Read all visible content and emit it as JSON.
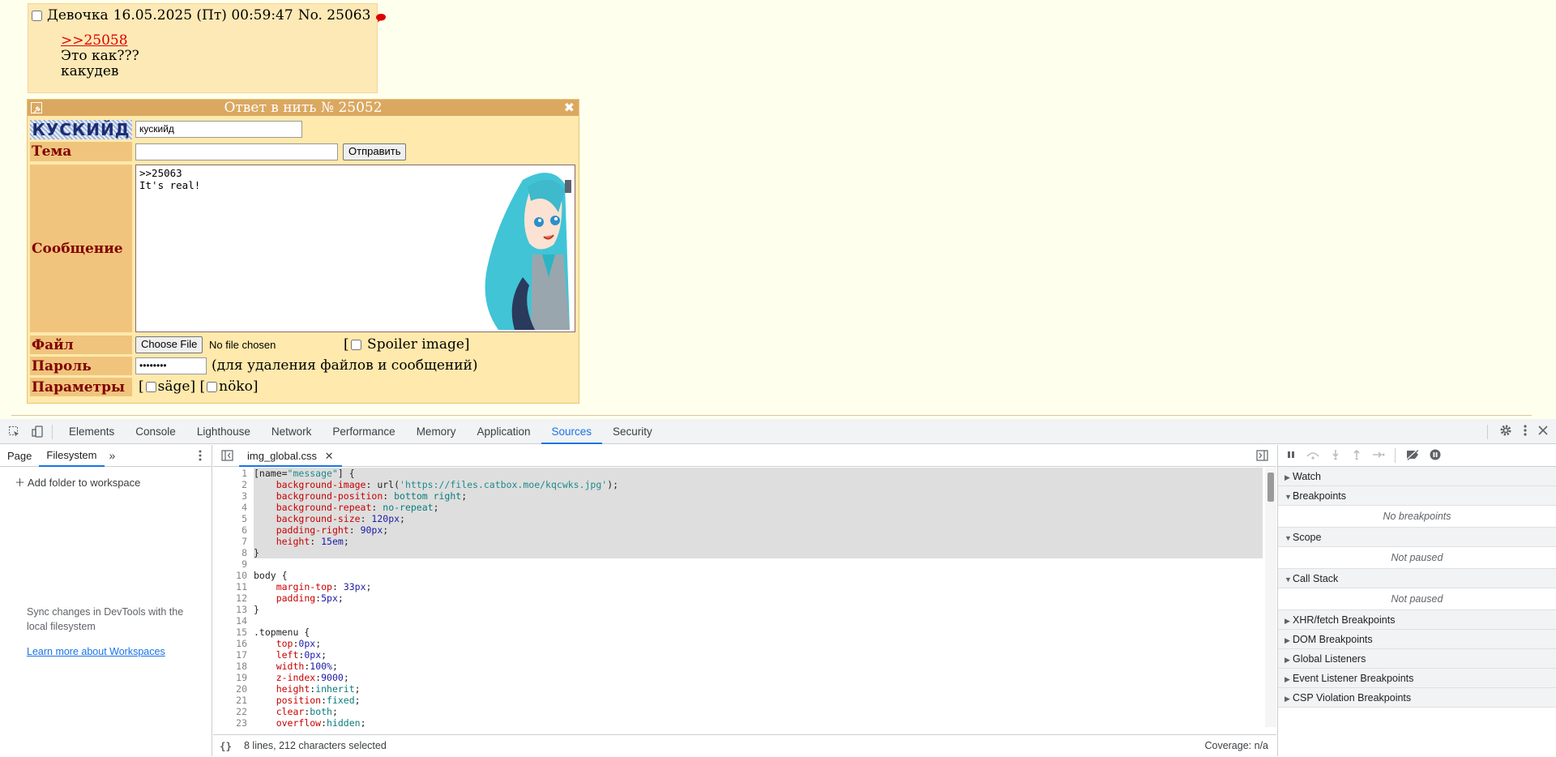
{
  "post": {
    "author": "Девочка",
    "date": "16.05.2025 (Пт) 00:59:47",
    "number_label": "No. 25063",
    "reply_link": ">>25058",
    "lines": [
      "Это как???",
      "какудев"
    ]
  },
  "reply_form": {
    "title": "Ответ в нить № 25052",
    "captcha_text": "КУСКИЙД",
    "captcha_value": "кускийд",
    "subject_label": "Тема",
    "submit_label": "Отправить",
    "message_label": "Сообщение",
    "message_lines": [
      ">>25063",
      "It's real!"
    ],
    "file_label": "Файл",
    "choose_file_label": "Choose File",
    "no_file_text": "No file chosen",
    "spoiler_label": "Spoiler image",
    "password_label": "Пароль",
    "password_value": "••••••••",
    "password_hint": "(для удаления файлов и сообщений)",
    "params_label": "Параметры",
    "sage_label": "säge",
    "noko_label": "nöko"
  },
  "devtools": {
    "tabs": [
      "Elements",
      "Console",
      "Lighthouse",
      "Network",
      "Performance",
      "Memory",
      "Application",
      "Sources",
      "Security"
    ],
    "active_tab": "Sources",
    "navigator": {
      "tabs": [
        "Page",
        "Filesystem"
      ],
      "active_tab": "Filesystem",
      "add_folder": "Add folder to workspace",
      "sync_text": "Sync changes in DevTools with the local filesystem",
      "learn_link": "Learn more about Workspaces"
    },
    "editor": {
      "file_tab": "img_global.css",
      "status_selection": "8 lines, 212 characters selected",
      "coverage": "Coverage: n/a",
      "code": [
        "[name=\"message\"] {",
        "    background-image: url('https://files.catbox.moe/kqcwks.jpg');",
        "    background-position: bottom right;",
        "    background-repeat: no-repeat;",
        "    background-size: 120px;",
        "    padding-right: 90px;",
        "    height: 15em;",
        "}",
        "",
        "body {",
        "    margin-top: 33px;",
        "    padding:5px;",
        "}",
        "",
        ".topmenu {",
        "    top:0px;",
        "    left:0px;",
        "    width:100%;",
        "    z-index:9000;",
        "    height:inherit;",
        "    position:fixed;",
        "    clear:both;",
        "    overflow:hidden;"
      ]
    },
    "debugger": {
      "sections": [
        {
          "title": "Watch",
          "open": false,
          "empty": ""
        },
        {
          "title": "Breakpoints",
          "open": true,
          "empty": "No breakpoints"
        },
        {
          "title": "Scope",
          "open": true,
          "empty": "Not paused"
        },
        {
          "title": "Call Stack",
          "open": true,
          "empty": "Not paused"
        },
        {
          "title": "XHR/fetch Breakpoints",
          "open": false,
          "empty": ""
        },
        {
          "title": "DOM Breakpoints",
          "open": false,
          "empty": ""
        },
        {
          "title": "Global Listeners",
          "open": false,
          "empty": ""
        },
        {
          "title": "Event Listener Breakpoints",
          "open": false,
          "empty": ""
        },
        {
          "title": "CSP Violation Breakpoints",
          "open": false,
          "empty": ""
        }
      ]
    }
  },
  "colors": {
    "accent": "#1a73e8",
    "post_bg": "#fde9b6",
    "label_bg": "#f0c47d",
    "title_bar": "#dba860",
    "reply_link": "#dd0000"
  }
}
